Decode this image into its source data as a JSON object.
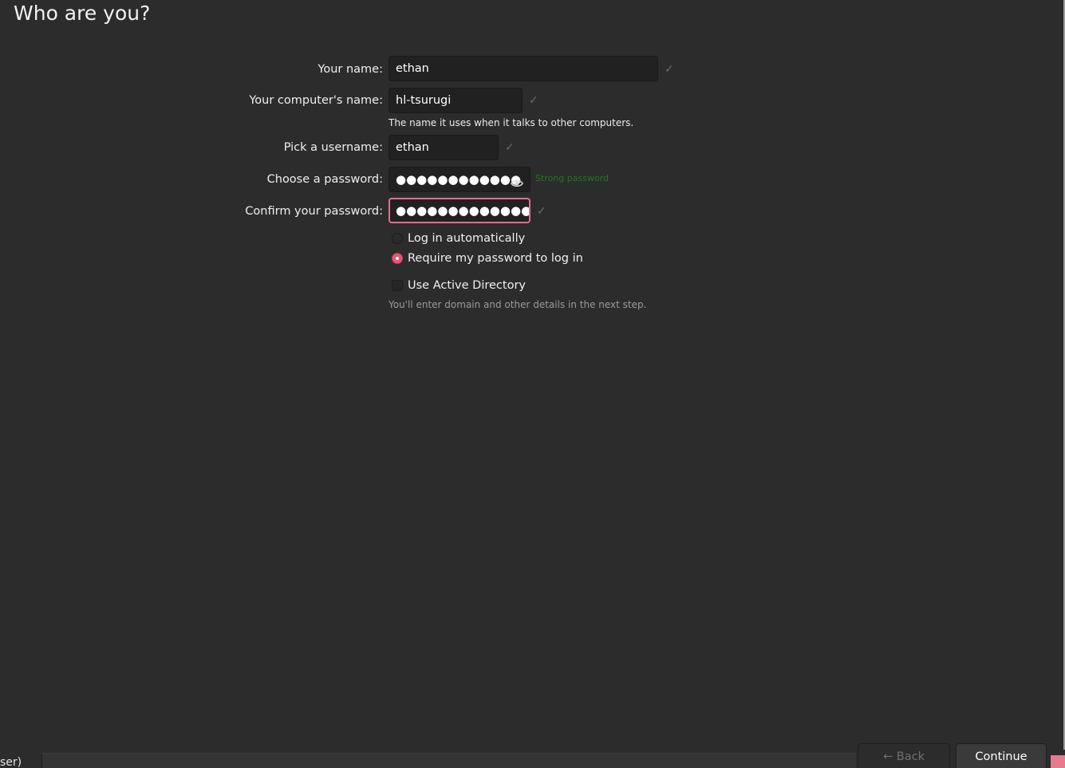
{
  "page": {
    "title": "Who are you?"
  },
  "form": {
    "name": {
      "label": "Your name:",
      "value": "ethan"
    },
    "computer_name": {
      "label": "Your computer's name:",
      "value": "hl-tsurugi",
      "hint": "The name it uses when it talks to other computers."
    },
    "username": {
      "label": "Pick a username:",
      "value": "ethan"
    },
    "password": {
      "label": "Choose a password:",
      "masked": "●●●●●●●●●●●●",
      "strength": "Strong password",
      "strength_color": "#1a7a1a"
    },
    "confirm_password": {
      "label": "Confirm your password:",
      "masked": "●●●●●●●●●●●●●●"
    },
    "check_glyph": "✓",
    "login_options": [
      {
        "label": "Log in automatically",
        "selected": false
      },
      {
        "label": "Require my password to log in",
        "selected": true
      }
    ],
    "active_directory": {
      "label": "Use Active Directory",
      "checked": false,
      "hint": "You'll enter domain and other details in the next step."
    }
  },
  "footer": {
    "back_label": "← Back",
    "continue_label": "Continue",
    "left_fragment": "ser)"
  },
  "colors": {
    "background": "#2c2c2c",
    "accent": "#e95478",
    "focus_border": "#e3708f"
  }
}
